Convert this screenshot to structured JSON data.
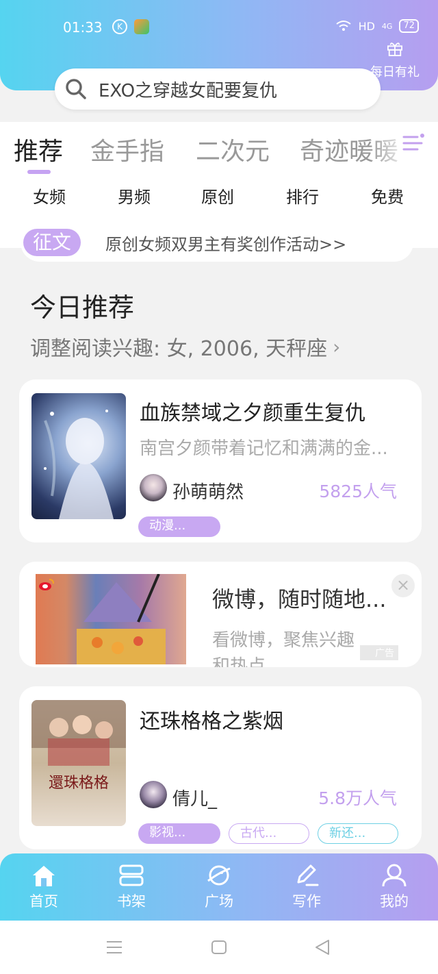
{
  "status_bar": {
    "time": "01:33",
    "network": "HD",
    "signal_label": "4G",
    "battery": "72"
  },
  "header": {
    "daily_gift_label": "每日有礼",
    "search_text": "EXO之穿越女配要复仇"
  },
  "top_tabs": [
    "推荐",
    "金手指",
    "二次元",
    "奇迹暖暖"
  ],
  "sub_tabs": [
    "女频",
    "男频",
    "原创",
    "排行",
    "免费"
  ],
  "promo": {
    "badge": "征文",
    "text": "原创女频双男主有奖创作活动>>"
  },
  "section": {
    "title": "今日推荐",
    "subtitle": "调整阅读兴趣: 女, 2006, 天秤座",
    "chevron": "›"
  },
  "books": [
    {
      "title": "血族禁域之夕颜重生复仇",
      "desc": "南宫夕颜带着记忆和满满的金...",
      "author": "孙萌萌然",
      "popularity": "5825人气",
      "tags": [
        "动漫..."
      ]
    },
    {
      "title": "还珠格格之紫烟",
      "desc": "",
      "author": "倩儿_",
      "popularity": "5.8万人气",
      "tags": [
        "影视...",
        "古代...",
        "新还..."
      ]
    }
  ],
  "ad": {
    "title": "微博，随时随地...",
    "desc_line1": "看微博，聚焦兴趣",
    "desc_line2": "和热点",
    "label": "广告",
    "close": "×"
  },
  "bottom_nav": [
    "首页",
    "书架",
    "广场",
    "写作",
    "我的"
  ],
  "colors": {
    "accent_purple": "#c8a8f2",
    "accent_cyan": "#55d4f0",
    "gradient_end": "#b69ef0"
  }
}
